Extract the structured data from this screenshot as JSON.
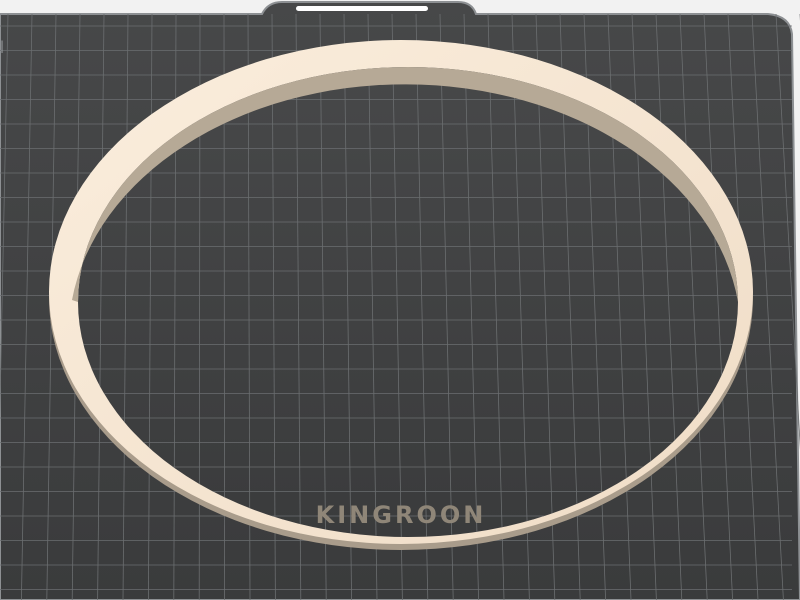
{
  "app": {
    "view": "3d-slicer-build-plate-preview"
  },
  "build_plate": {
    "surface_color": "#3d3e3f",
    "grid_line_color": "#6b6e70",
    "edge_color": "#8d9093",
    "notch_handle_color": "#ffffff"
  },
  "model": {
    "type": "circular-ring",
    "ring_color": "#f4e5d2",
    "ring_side_color": "#a99c8b",
    "embossed_text": "KINGROON",
    "embossed_text_color": "#8f8678"
  }
}
